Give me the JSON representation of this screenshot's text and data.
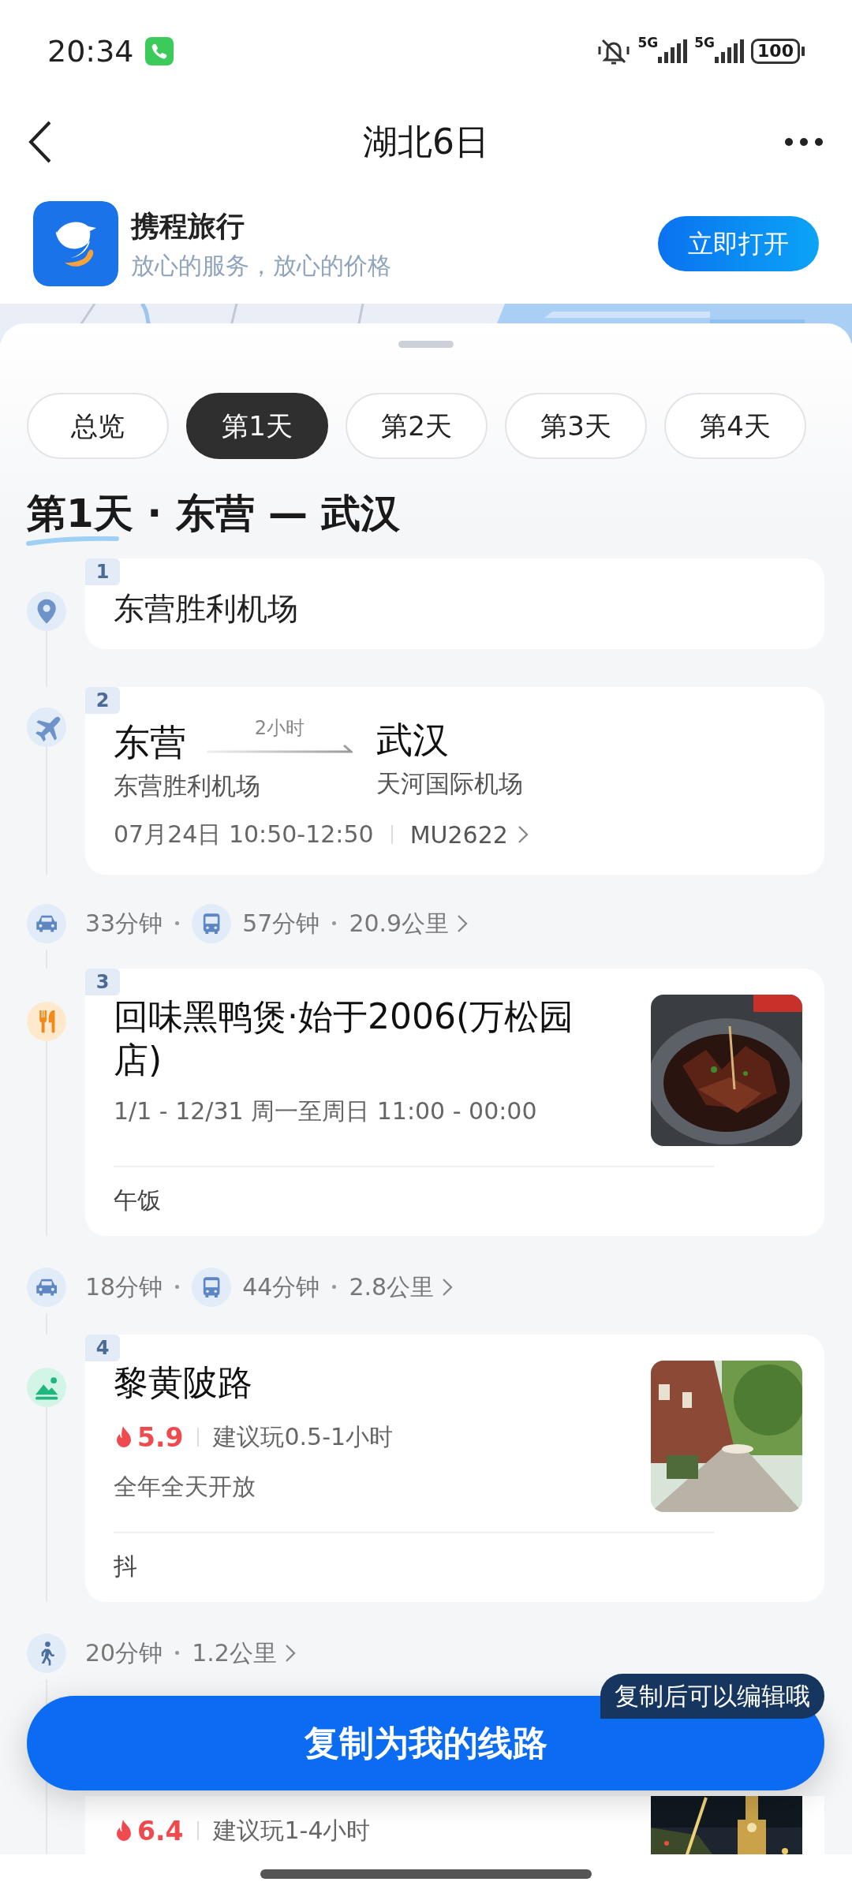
{
  "status_bar": {
    "time": "20:34",
    "network_1": "5G",
    "network_2": "5G",
    "battery": "100"
  },
  "nav": {
    "title": "湖北6日"
  },
  "app_banner": {
    "name": "携程旅行",
    "slogan": "放心的服务，放心的价格",
    "button": "立即打开"
  },
  "tabs": [
    {
      "label": "总览",
      "selected": false
    },
    {
      "label": "第1天",
      "selected": true
    },
    {
      "label": "第2天",
      "selected": false
    },
    {
      "label": "第3天",
      "selected": false
    },
    {
      "label": "第4天",
      "selected": false
    }
  ],
  "day_heading": "第1天 · 东营 — 武汉",
  "timeline": [
    {
      "kind": "place",
      "index": "1",
      "title": "东营胜利机场"
    },
    {
      "kind": "flight",
      "index": "2",
      "from_city": "东营",
      "duration": "2小时",
      "to_city": "武汉",
      "from_airport": "东营胜利机场",
      "to_airport": "天河国际机场",
      "time": "07月24日 10:50-12:50",
      "flight_no": "MU2622"
    },
    {
      "kind": "transit",
      "modes": [
        {
          "kind": "car",
          "text": "33分钟"
        },
        {
          "kind": "bus",
          "text": "57分钟"
        }
      ],
      "distance": "20.9公里"
    },
    {
      "kind": "restaurant",
      "index": "3",
      "title": "回味黑鸭煲·始于2006(万松园店)",
      "hours": "1/1 - 12/31 周一至周日 11:00 - 00:00",
      "note": "午饭"
    },
    {
      "kind": "transit",
      "modes": [
        {
          "kind": "car",
          "text": "18分钟"
        },
        {
          "kind": "bus",
          "text": "44分钟"
        }
      ],
      "distance": "2.8公里"
    },
    {
      "kind": "sight",
      "index": "4",
      "title": "黎黄陂路",
      "heat": "5.9",
      "duration": "建议玩0.5-1小时",
      "open": "全年全天开放",
      "note": "抖"
    },
    {
      "kind": "transit",
      "modes": [
        {
          "kind": "walk",
          "text": "20分钟"
        }
      ],
      "distance": "1.2公里"
    },
    {
      "kind": "sight",
      "heat": "6.4",
      "duration": "建议玩1-4小时"
    }
  ],
  "tip": "复制后可以编辑哦",
  "copy_button": "复制为我的线路"
}
